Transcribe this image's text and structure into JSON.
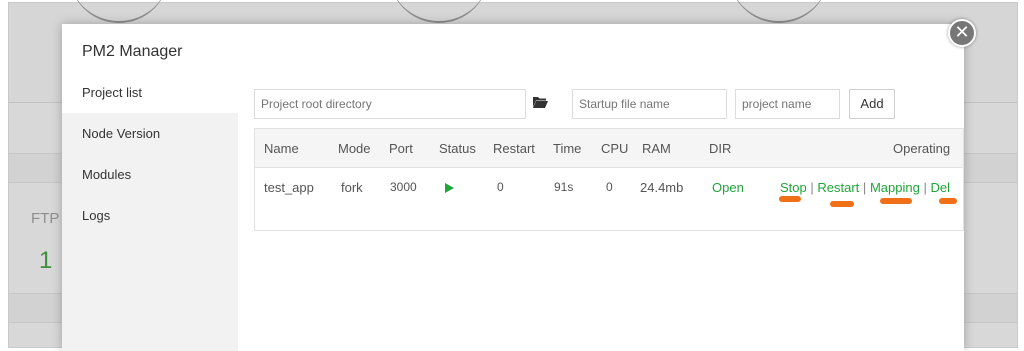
{
  "background": {
    "ftp_label": "FTP",
    "ftp_count": "1"
  },
  "modal": {
    "title": "PM2 Manager",
    "close_icon": "close-icon"
  },
  "sidebar": {
    "items": [
      {
        "label": "Project list"
      },
      {
        "label": "Node Version"
      },
      {
        "label": "Modules"
      },
      {
        "label": "Logs"
      }
    ]
  },
  "toolbar": {
    "project_root_placeholder": "Project root directory",
    "folder_icon": "folder-open-icon",
    "startup_file_placeholder": "Startup file name",
    "project_name_placeholder": "project name",
    "add_label": "Add"
  },
  "table": {
    "headers": [
      "Name",
      "Mode",
      "Port",
      "Status",
      "Restart",
      "Time",
      "CPU",
      "RAM",
      "DIR",
      "Operating"
    ],
    "rows": [
      {
        "name": "test_app",
        "mode": "fork",
        "port": "3000",
        "status_icon": "play-icon",
        "restart": "0",
        "time": "91s",
        "cpu": "0",
        "ram": "24.4mb",
        "dir": "Open",
        "ops": {
          "stop": "Stop",
          "restart": "Restart",
          "mapping": "Mapping",
          "del": "Del",
          "separator": "|"
        }
      }
    ]
  },
  "colors": {
    "accent_green": "#20a53a",
    "annotation_orange": "#f07018"
  }
}
